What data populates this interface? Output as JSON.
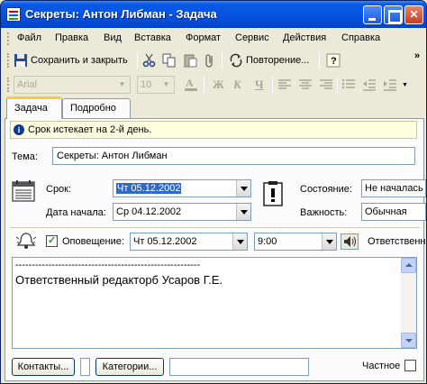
{
  "window": {
    "title": "Секреты: Антон Либман - Задача",
    "controls": [
      "minimize",
      "maximize",
      "close"
    ]
  },
  "menu": [
    "Файл",
    "Правка",
    "Вид",
    "Вставка",
    "Формат",
    "Сервис",
    "Действия",
    "Справка"
  ],
  "toolbar": {
    "save_close": "Сохранить и закрыть",
    "recurrence": "Повторение...",
    "font": "Arial",
    "size": "10",
    "bold": "Ж",
    "italic": "К",
    "underline": "Ч"
  },
  "tabs": [
    "Задача",
    "Подробно"
  ],
  "info": "Срок истекает на 2-й день.",
  "form": {
    "subject_label": "Тема:",
    "subject_value": "Секреты: Антон Либман",
    "due_label": "Срок:",
    "due_value": "Чт 05.12.2002",
    "start_label": "Дата начала:",
    "start_value": "Ср 04.12.2002",
    "status_label": "Состояние:",
    "status_value": "Не началась",
    "priority_label": "Важность:",
    "priority_value": "Обычная",
    "reminder_label": "Оповещение:",
    "reminder_checked": true,
    "reminder_date": "Чт 05.12.2002",
    "reminder_time": "9:00",
    "owner_label": "Ответственн"
  },
  "body": {
    "line1": "--------------------------------------------------------",
    "line2": "Ответственный редакторб Усаров Г.Е."
  },
  "footer": {
    "contacts": "Контакты...",
    "categories": "Категории...",
    "private_label": "Частное"
  }
}
